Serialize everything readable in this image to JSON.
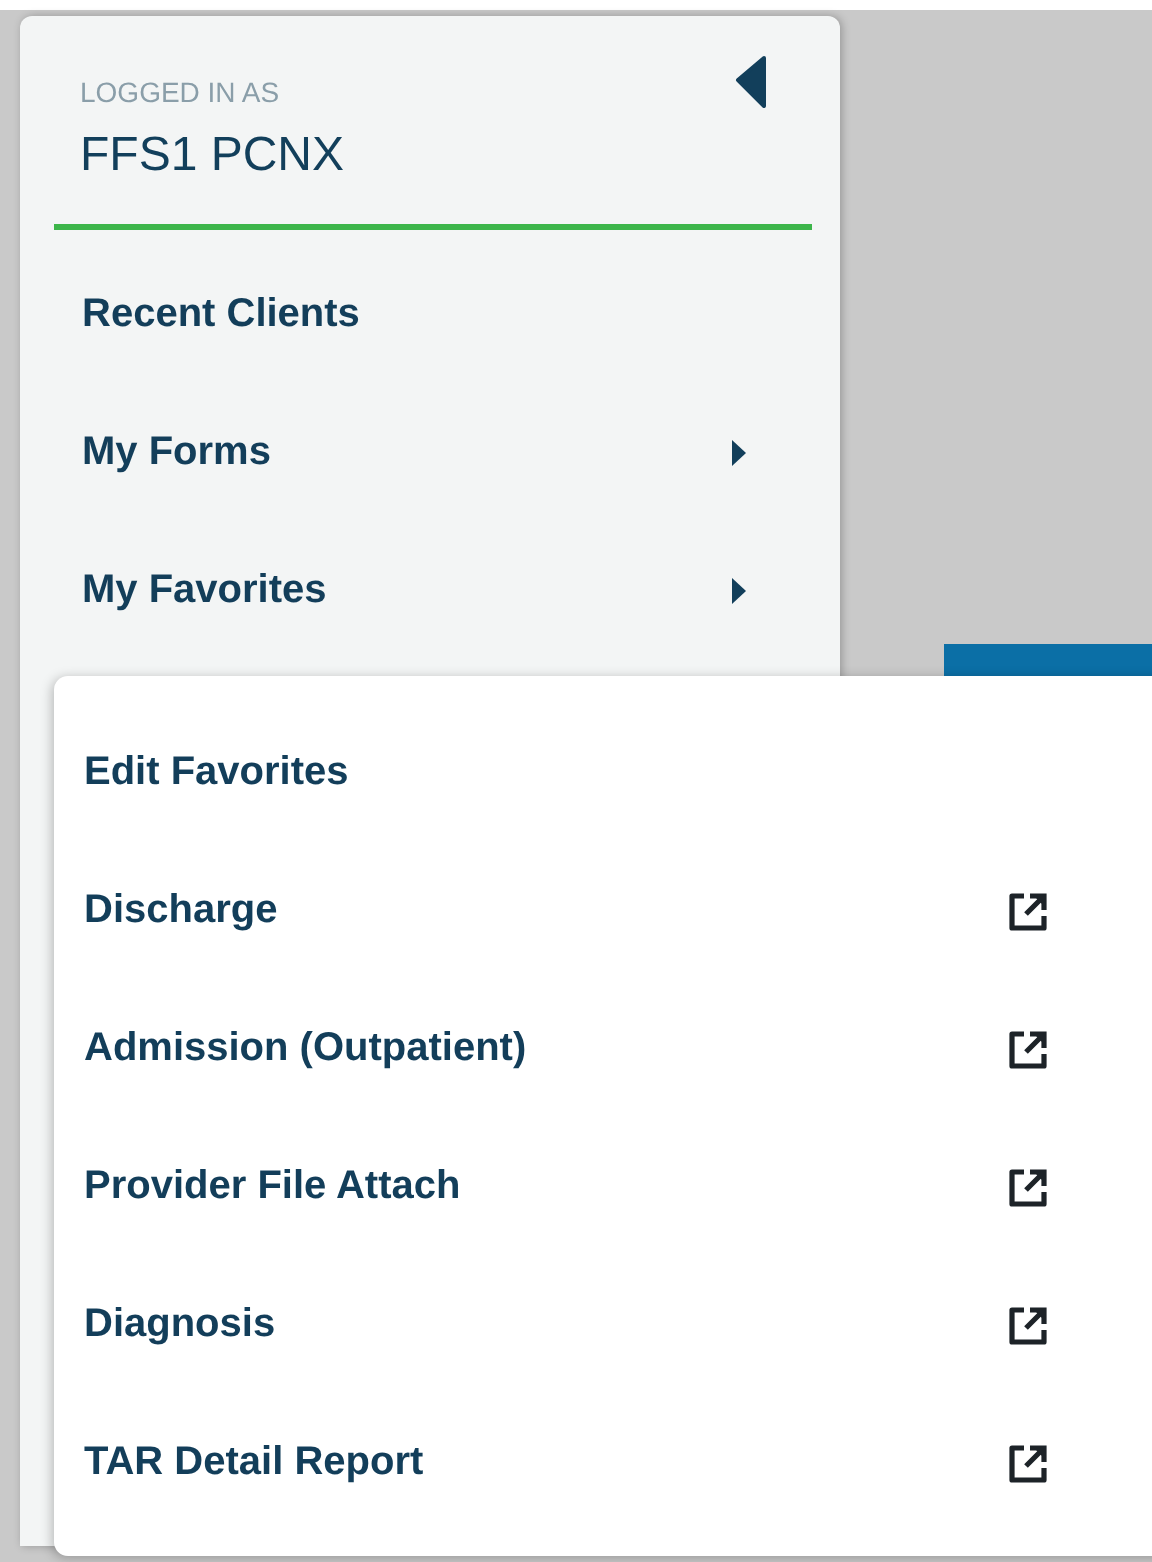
{
  "sidebar": {
    "logged_in_label": "LOGGED IN AS",
    "user_name": "FFS1 PCNX",
    "items": [
      {
        "label": "Recent Clients",
        "has_submenu": false
      },
      {
        "label": "My Forms",
        "has_submenu": true
      },
      {
        "label": "My Favorites",
        "has_submenu": true
      }
    ]
  },
  "favorites_menu": {
    "items": [
      {
        "label": "Edit Favorites",
        "opens_external": false
      },
      {
        "label": "Discharge",
        "opens_external": true
      },
      {
        "label": "Admission (Outpatient)",
        "opens_external": true
      },
      {
        "label": "Provider File Attach",
        "opens_external": true
      },
      {
        "label": "Diagnosis",
        "opens_external": true
      },
      {
        "label": "TAR Detail Report",
        "opens_external": true
      }
    ]
  }
}
